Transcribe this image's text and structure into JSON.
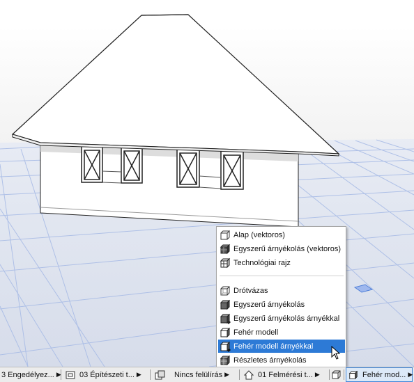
{
  "viewport": {
    "name": "3D house model view"
  },
  "menu": {
    "items": [
      {
        "label": "Alap (vektoros)",
        "icon": "basic-vector-icon"
      },
      {
        "label": "Egyszerű árnyékolás (vektoros)",
        "icon": "simple-shading-vector-icon"
      },
      {
        "label": "Technológiai rajz",
        "icon": "technical-drawing-icon"
      },
      {
        "label": "Drótvázas",
        "icon": "wireframe-icon"
      },
      {
        "label": "Egyszerű árnyékolás",
        "icon": "simple-shading-icon"
      },
      {
        "label": "Egyszerű árnyékolás árnyékkal",
        "icon": "simple-shading-shadows-icon"
      },
      {
        "label": "Fehér modell",
        "icon": "white-model-icon"
      },
      {
        "label": "Fehér modell árnyékkal",
        "icon": "white-model-shadows-icon",
        "selected": true
      },
      {
        "label": "Részletes árnyékolás",
        "icon": "detailed-shading-icon"
      }
    ]
  },
  "statusbar": {
    "item1": "3 Engedélyez...",
    "item2": "03 Építészeti t...",
    "item3": "Nincs felülírás",
    "item4": "01 Felmérési t...",
    "item5": "Fehér mod..."
  },
  "colors": {
    "accent": "#2d7ad6",
    "grid": "#aebfe6",
    "background": "#ffffff"
  }
}
